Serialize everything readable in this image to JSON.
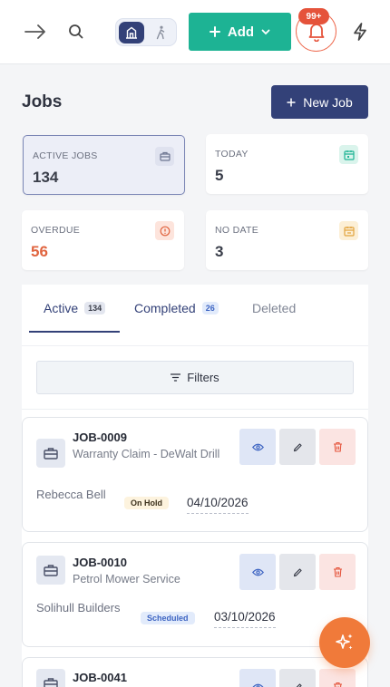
{
  "header": {
    "add_label": "Add",
    "notification_badge": "99+"
  },
  "page": {
    "title": "Jobs",
    "new_job_label": "New Job"
  },
  "stats": [
    {
      "label": "ACTIVE JOBS",
      "value": "134",
      "icon": "briefcase-icon",
      "color": "#6c7590"
    },
    {
      "label": "TODAY",
      "value": "5",
      "icon": "calendar-icon",
      "color": "#1db394"
    },
    {
      "label": "OVERDUE",
      "value": "56",
      "icon": "alert-circle-icon",
      "color": "#e0643f"
    },
    {
      "label": "NO DATE",
      "value": "3",
      "icon": "calendar-empty-icon",
      "color": "#e2a33d"
    }
  ],
  "tabs": [
    {
      "label": "Active",
      "count": "134"
    },
    {
      "label": "Completed",
      "count": "26"
    },
    {
      "label": "Deleted",
      "count": ""
    }
  ],
  "filters_label": "Filters",
  "jobs": [
    {
      "id": "JOB-0009",
      "title": "Warranty Claim - DeWalt Drill",
      "client": "Rebecca Bell",
      "status": "On Hold",
      "date": "04/10/2026"
    },
    {
      "id": "JOB-0010",
      "title": "Petrol Mower Service",
      "client": "Solihull Builders",
      "status": "Scheduled",
      "date": "03/10/2026"
    },
    {
      "id": "JOB-0041",
      "title": "",
      "client": "",
      "status": "",
      "date": ""
    }
  ],
  "colors": {
    "primary": "#334178",
    "accent": "#1db394",
    "danger": "#e5533b",
    "fab": "#f07a3a"
  }
}
